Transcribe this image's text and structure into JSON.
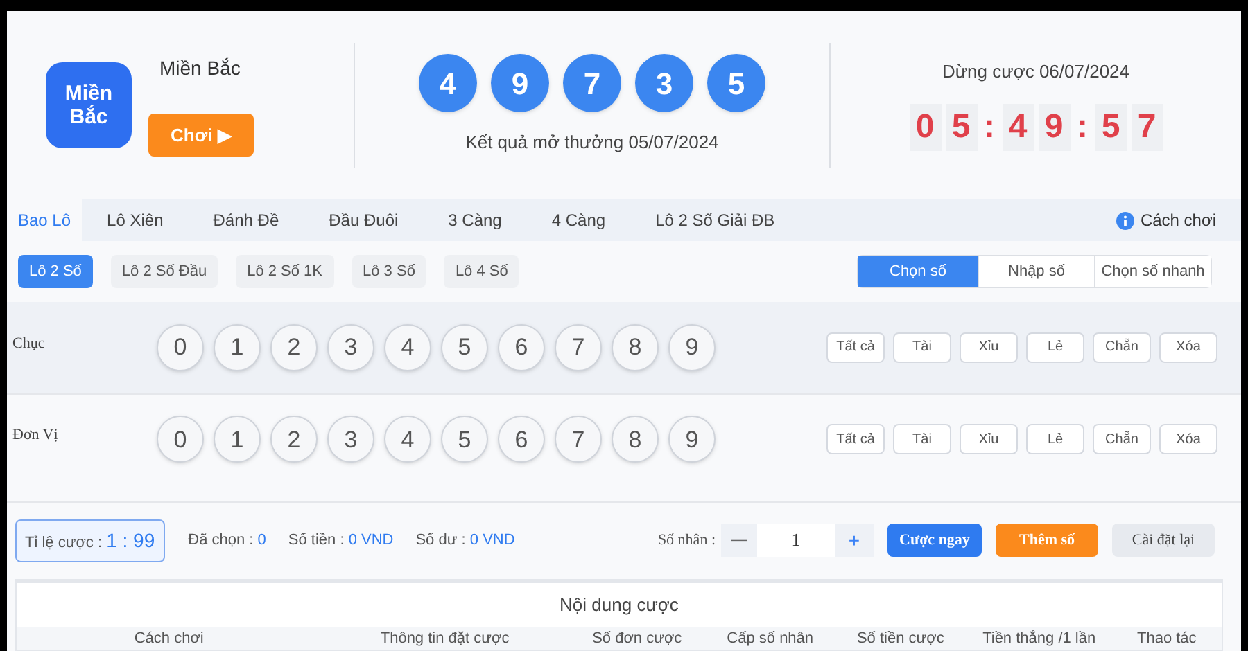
{
  "header": {
    "logo_text": "Miền Bắc",
    "region": "Miền Bắc",
    "region_button": "Chơi ▶",
    "results": [
      "4",
      "9",
      "7",
      "3",
      "5"
    ],
    "results_caption": "Kết quả mở thưởng 05/07/2024",
    "stop_label": "Dừng cược 06/07/2024",
    "countdown": [
      {
        "kind": "digit",
        "text": "0"
      },
      {
        "kind": "digit",
        "text": "5"
      },
      {
        "kind": "sep",
        "text": ":"
      },
      {
        "kind": "digit",
        "text": "4"
      },
      {
        "kind": "digit",
        "text": "9"
      },
      {
        "kind": "sep",
        "text": ":"
      },
      {
        "kind": "digit",
        "text": "5"
      },
      {
        "kind": "digit",
        "text": "7"
      }
    ]
  },
  "tabs": [
    {
      "label": "Bao Lô",
      "selected": true
    },
    {
      "label": "Lô Xiên",
      "selected": false
    },
    {
      "label": "Đánh Đề",
      "selected": false
    },
    {
      "label": "Đầu Đuôi",
      "selected": false
    },
    {
      "label": "3 Càng",
      "selected": false
    },
    {
      "label": "4 Càng",
      "selected": false
    },
    {
      "label": "Lô 2 Số Giải ĐB",
      "selected": false
    }
  ],
  "help_link": "Cách chơi",
  "subtabs": [
    {
      "label": "Lô 2 Số",
      "selected": true
    },
    {
      "label": "Lô 2 Số Đầu",
      "selected": false
    },
    {
      "label": "Lô 2 Số 1K",
      "selected": false
    },
    {
      "label": "Lô 3 Số",
      "selected": false
    },
    {
      "label": "Lô 4 Số",
      "selected": false
    }
  ],
  "modes": [
    {
      "label": "Chọn số",
      "selected": true
    },
    {
      "label": "Nhập số",
      "selected": false
    },
    {
      "label": "Chọn số nhanh",
      "selected": false
    }
  ],
  "pick_rows": [
    {
      "label": "Chục",
      "numbers": [
        "0",
        "1",
        "2",
        "3",
        "4",
        "5",
        "6",
        "7",
        "8",
        "9"
      ],
      "filters": [
        "Tất cả",
        "Tài",
        "Xỉu",
        "Lẻ",
        "Chẵn",
        "Xóa"
      ]
    },
    {
      "label": "Đơn Vị",
      "numbers": [
        "0",
        "1",
        "2",
        "3",
        "4",
        "5",
        "6",
        "7",
        "8",
        "9"
      ],
      "filters": [
        "Tất cả",
        "Tài",
        "Xỉu",
        "Lẻ",
        "Chẵn",
        "Xóa"
      ]
    }
  ],
  "summary": {
    "odds_label": "Tỉ lệ cược : ",
    "odds": "1 : 99",
    "stats": [
      {
        "label": "Đã chọn : ",
        "value": "0"
      },
      {
        "label": "Số tiền : ",
        "value": "0 VND"
      },
      {
        "label": "Số dư : ",
        "value": "0 VND"
      }
    ],
    "multiplier_label": "Số nhân :",
    "minus": "—",
    "multiplier": "1",
    "plus": "+",
    "bet_button": "Cược ngay",
    "add_button": "Thêm số",
    "reset_button": "Cài đặt lại"
  },
  "bet_table": {
    "title": "Nội dung cược",
    "columns": [
      "Cách chơi",
      "Thông tin đặt cược",
      "Số đơn cược",
      "Cấp số nhân",
      "Số tiền cược",
      "Tiền thắng /1 lần",
      "Thao tác"
    ]
  }
}
